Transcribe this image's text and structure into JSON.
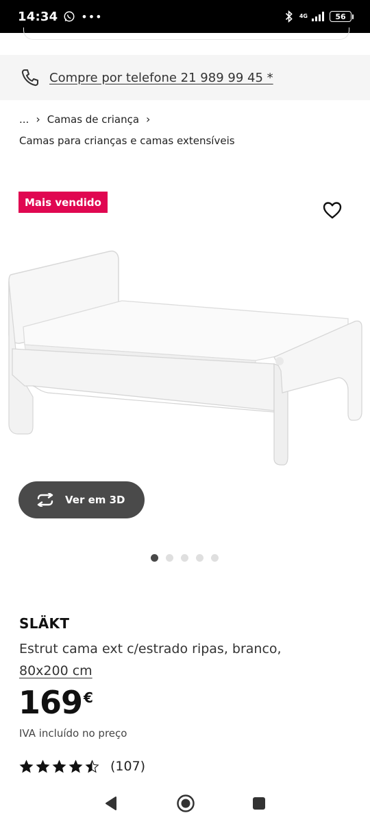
{
  "status": {
    "time": "14:34",
    "network": "4G",
    "network_sub": "4G",
    "battery": "56"
  },
  "phone_banner": {
    "text": "Compre por telefone 21 989 99 45 *",
    "icon": "phone-icon"
  },
  "breadcrumb": {
    "ellipsis": "...",
    "item1": "Camas de criança",
    "item2": "Camas para crianças e camas extensíveis"
  },
  "product": {
    "badge": "Mais vendido",
    "view3d_label": "Ver em 3D",
    "carousel": {
      "count": 5,
      "active": 1
    },
    "brand": "SLÄKT",
    "description": "Estrut cama ext c/estrado ripas, branco,",
    "size": "80x200 cm",
    "price": "169",
    "currency": "€",
    "vat_note": "IVA incluído no preço",
    "rating": 4.5,
    "reviews": "(107)"
  },
  "colors": {
    "badge": "#e00751",
    "button_3d": "#4a4a4a",
    "banner_bg": "#f5f5f5"
  }
}
